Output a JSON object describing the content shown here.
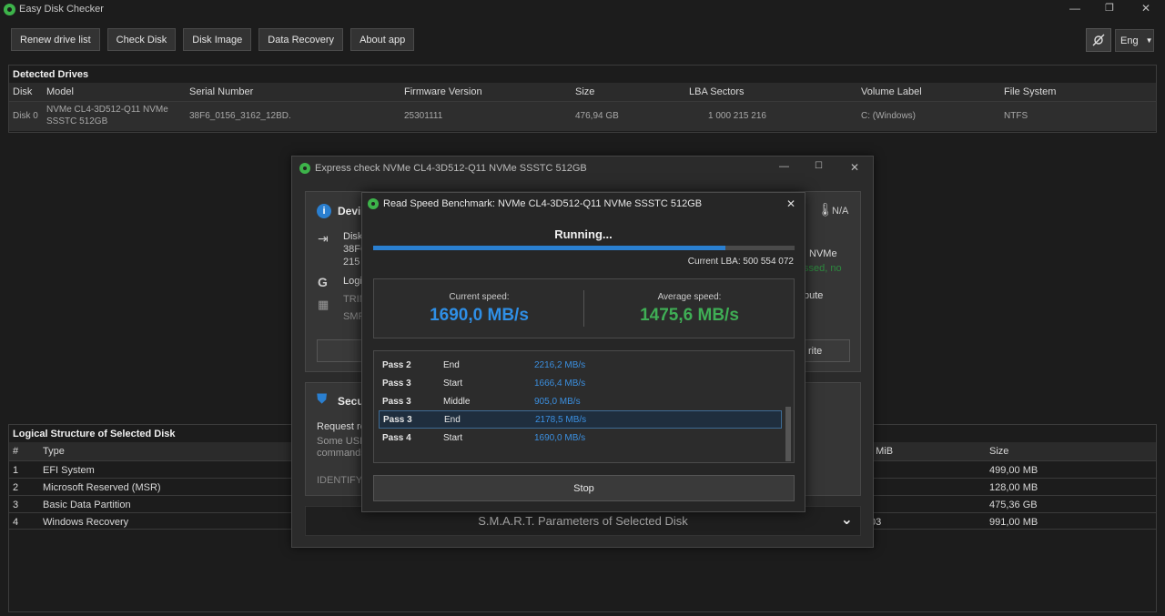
{
  "window": {
    "title": "Easy Disk Checker"
  },
  "toolbar": {
    "buttons": [
      "Renew drive list",
      "Check Disk",
      "Disk Image",
      "Data Recovery",
      "About app"
    ],
    "language": "Eng"
  },
  "drives": {
    "title": "Detected Drives",
    "columns": [
      "Disk",
      "Model",
      "Serial Number",
      "Firmware Version",
      "Size",
      "LBA Sectors",
      "Volume Label",
      "File System"
    ],
    "row": {
      "disk": "Disk 0",
      "model_line1": "NVMe CL4-3D512-Q11 NVMe",
      "model_line2": "SSSTC 512GB",
      "serial": "38F6_0156_3162_12BD.",
      "firmware": "25301111",
      "size": "476,94 GB",
      "lba": "1 000 215 216",
      "volume": "C: (Windows)",
      "fs": "NTFS"
    }
  },
  "logical": {
    "title": "Logical Structure of Selected Disk",
    "columns": [
      "#",
      "Type",
      "t MiB",
      "Size"
    ],
    "rows": [
      {
        "num": "1",
        "type": "EFI System",
        "extra": "",
        "size": "499,00 MB"
      },
      {
        "num": "2",
        "type": "Microsoft Reserved (MSR)",
        "extra": "",
        "size": "128,00 MB"
      },
      {
        "num": "3",
        "type": "Basic Data Partition",
        "extra": "",
        "size": "475,36 GB"
      },
      {
        "num": "4",
        "type": "Windows Recovery",
        "extra": "03",
        "size": "991,00 MB"
      }
    ]
  },
  "express": {
    "title": "Express check NVMe CL4-3D512-Q11 NVMe SSSTC 512GB",
    "device_heading": "Devi",
    "temp": "N/A",
    "disk_label": "Disk",
    "disk_sub1": "38F6",
    "disk_sub2": "215",
    "logic_label": "Logi",
    "trim_label": "TRIM",
    "smr_label": "SMR",
    "nvme_label": "NVMe",
    "passed_label": "ssed, no",
    "attribute_label": "bute",
    "write_label": "rite",
    "security_heading": "Secu",
    "request_label": "Request re",
    "usb_label": "Some USB-",
    "commands_label": "commands",
    "identify_label": "IDENTIFY D",
    "smart_label": "S.M.A.R.T. Parameters of Selected Disk"
  },
  "bench": {
    "title": "Read Speed Benchmark: NVMe CL4-3D512-Q11 NVMe SSSTC 512GB",
    "status": "Running...",
    "progress": 0.836,
    "current_lba": "Current LBA: 500 554 072",
    "current_label": "Current speed:",
    "current_value": "1690,0 MB/s",
    "average_label": "Average speed:",
    "average_value": "1475,6 MB/s",
    "passes": [
      {
        "pass": "Pass 2",
        "phase": "End",
        "speed": "2216,2 MB/s"
      },
      {
        "pass": "Pass 3",
        "phase": "Start",
        "speed": "1666,4 MB/s"
      },
      {
        "pass": "Pass 3",
        "phase": "Middle",
        "speed": "905,0 MB/s"
      },
      {
        "pass": "Pass 3",
        "phase": "End",
        "speed": "2178,5 MB/s"
      },
      {
        "pass": "Pass 4",
        "phase": "Start",
        "speed": "1690,0 MB/s"
      }
    ],
    "stop_label": "Stop"
  },
  "colors": {
    "accent": "#2a7fd0",
    "green": "#3db34a",
    "speed_blue": "#2f8fe6",
    "speed_green": "#3fae55"
  }
}
